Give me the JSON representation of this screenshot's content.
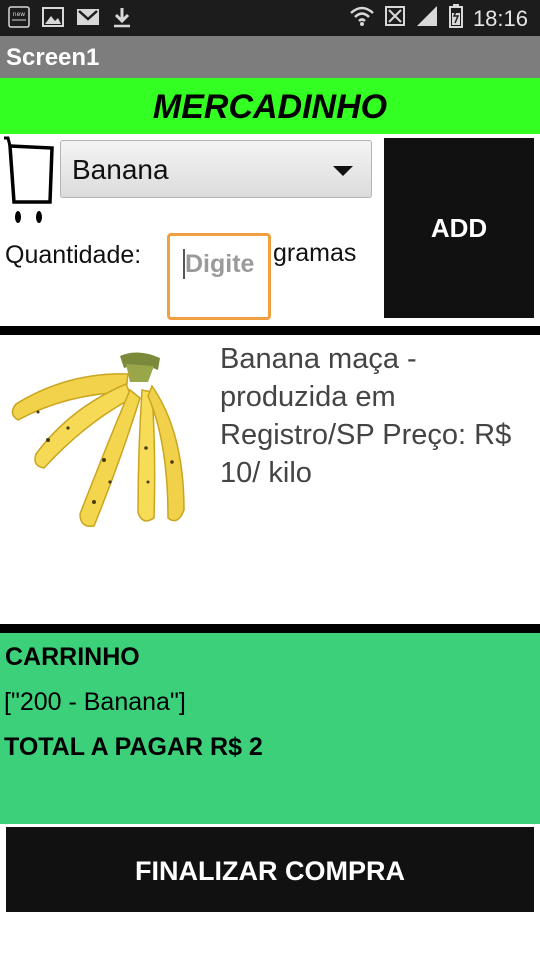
{
  "status_bar": {
    "left_icons": [
      "news-app-icon",
      "image-icon",
      "gmail-icon",
      "download-icon"
    ],
    "right_icons": [
      "wifi-icon",
      "sim-icon",
      "signal-icon",
      "battery-icon"
    ],
    "time": "18:16"
  },
  "app": {
    "title": "Screen1"
  },
  "header": {
    "title": "MERCADINHO",
    "bg_color": "#33ff22"
  },
  "form": {
    "product_select": "Banana",
    "quantity_label": "Quantidade:",
    "quantity_placeholder": "Digite",
    "unit_label": "gramas",
    "add_button": "ADD"
  },
  "product": {
    "description": "Banana maça - produzida em Registro/SP  Preço: R$ 10/ kilo",
    "image_icon": "banana-image"
  },
  "cart": {
    "title": "CARRINHO",
    "items": "[\"200 - Banana\"]",
    "total": "TOTAL A PAGAR R$ 2",
    "bg_color": "#3dd07a"
  },
  "footer": {
    "finalize_button": "FINALIZAR COMPRA"
  }
}
